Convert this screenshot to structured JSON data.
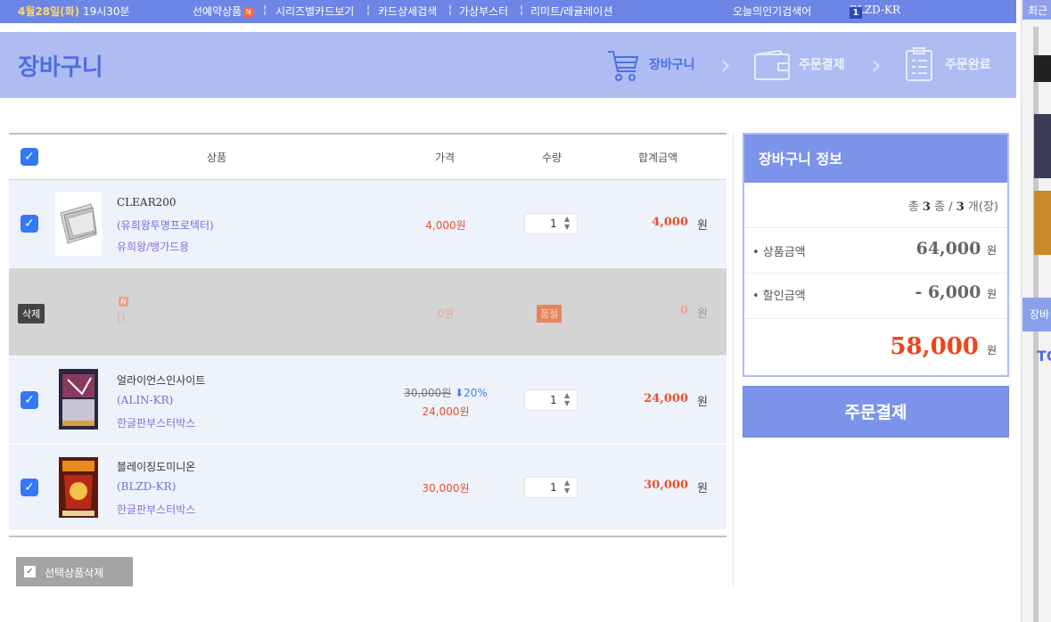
{
  "topbar": {
    "date": "4월28일(화)",
    "time": "19시30분",
    "links": [
      "선예약상품",
      "시리즈별카드보기",
      "카드상세검색",
      "가상부스터",
      "리미트/레귤레이션"
    ],
    "new_badge": "N",
    "separator": "¦",
    "popular_label": "오늘의인기검색어",
    "popular_rank": "1",
    "popular_term": "BLZD-KR"
  },
  "header": {
    "title": "장바구니",
    "steps": [
      "장바구니",
      "주문결제",
      "주문완료"
    ],
    "step_icons": [
      "cart-icon",
      "wallet-icon",
      "clipboard-icon"
    ]
  },
  "table": {
    "headers": {
      "product": "상품",
      "price": "가격",
      "qty": "수량",
      "total": "합계금액"
    },
    "rows": [
      {
        "name": "CLEAR200",
        "code": "(유희왕투명프로텍터)",
        "category": "유희왕/뱅가드용",
        "price": "4,000원",
        "qty": "1",
        "total": "4,000",
        "unit": "원"
      },
      {
        "code": "()",
        "price": "0원",
        "qty_label": "품절",
        "total": "0",
        "unit": "원",
        "delete_label": "삭제",
        "badge": "N"
      },
      {
        "name": "얼라이언스인사이트",
        "code": "(ALIN-KR)",
        "category": "한글판부스터박스",
        "price_old": "30,000원",
        "discount": "20%",
        "price": "24,000원",
        "qty": "1",
        "total": "24,000",
        "unit": "원"
      },
      {
        "name": "블레이징도미니온",
        "code": "(BLZD-KR)",
        "category": "한글판부스터박스",
        "price": "30,000원",
        "qty": "1",
        "total": "30,000",
        "unit": "원"
      }
    ],
    "bulk_delete": "선택상품삭제"
  },
  "summary": {
    "title": "장바구니 정보",
    "count_prefix": "총",
    "kinds": "3",
    "kinds_unit": "종 /",
    "items": "3",
    "items_unit": "개(장)",
    "goods_label": "• 상품금액",
    "goods_amount": "64,000",
    "discount_label": "• 할인금액",
    "discount_amount": "- 6,000",
    "final_amount": "58,000",
    "won": "원",
    "checkout": "주문결제"
  },
  "side": {
    "top": "최근",
    "btn": "장바",
    "to": "TO"
  },
  "colors": {
    "accent": "#7b94ea",
    "header_bg": "#aebcf2",
    "price_red": "#e8502a",
    "check_blue": "#3478f6"
  }
}
